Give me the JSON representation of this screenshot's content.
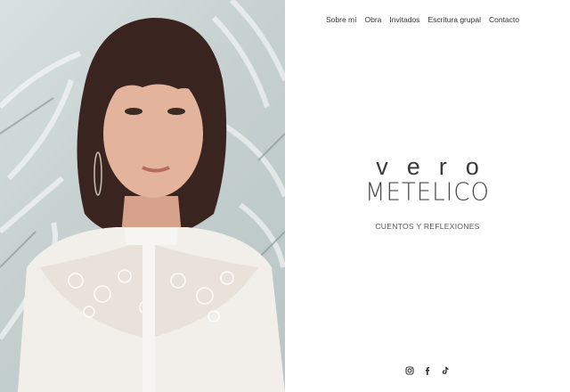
{
  "nav": {
    "items": [
      {
        "label": "Sobre mí"
      },
      {
        "label": "Obra"
      },
      {
        "label": "Invitados"
      },
      {
        "label": "Escritura grupal"
      },
      {
        "label": "Contacto"
      }
    ]
  },
  "brand": {
    "line1": "vero",
    "line2": "METELICO"
  },
  "tagline": "CUENTOS Y REFLEXIONES",
  "social": {
    "icons": [
      "instagram-icon",
      "facebook-icon",
      "tiktok-icon"
    ]
  },
  "colors": {
    "text": "#333333",
    "background": "#ffffff",
    "photo_wall": "#c5d0cf"
  }
}
